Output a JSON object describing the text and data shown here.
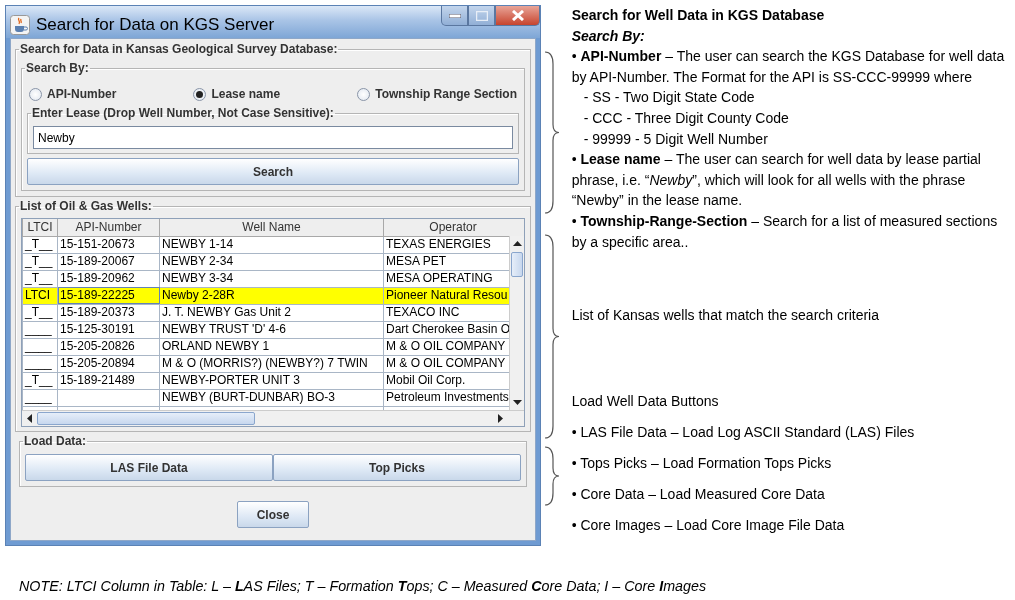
{
  "window": {
    "title": "Search for Data on KGS Server"
  },
  "search_panel": {
    "title": "Search for Data in Kansas Geological Survey Database:",
    "search_by": {
      "title": "Search By:",
      "options": [
        {
          "label": "API-Number",
          "selected": false
        },
        {
          "label": "Lease name",
          "selected": true
        },
        {
          "label": "Township Range Section",
          "selected": false
        }
      ]
    },
    "lease": {
      "title": "Enter Lease (Drop Well Number, Not Case Sensitive):",
      "value": "Newby"
    },
    "search_button": "Search"
  },
  "wells_panel": {
    "title": "List of Oil & Gas Wells:",
    "columns": [
      "LTCI",
      "API-Number",
      "Well Name",
      "Operator"
    ],
    "rows": [
      {
        "ltci": "_T__",
        "api": "15-151-20673",
        "well_name": "NEWBY 1-14",
        "operator": "TEXAS ENERGIES",
        "selected": false
      },
      {
        "ltci": "_T__",
        "api": "15-189-20067",
        "well_name": "NEWBY 2-34",
        "operator": "MESA PET",
        "selected": false
      },
      {
        "ltci": "_T__",
        "api": "15-189-20962",
        "well_name": "NEWBY 3-34",
        "operator": "MESA OPERATING",
        "selected": false
      },
      {
        "ltci": "LTCI",
        "api": "15-189-22225",
        "well_name": "Newby 2-28R",
        "operator": "Pioneer Natural Resou",
        "selected": true
      },
      {
        "ltci": "_T__",
        "api": "15-189-20373",
        "well_name": "J. T. NEWBY Gas Unit 2",
        "operator": "TEXACO INC",
        "selected": false
      },
      {
        "ltci": "____",
        "api": "15-125-30191",
        "well_name": "NEWBY TRUST 'D' 4-6",
        "operator": "Dart Cherokee Basin O",
        "selected": false
      },
      {
        "ltci": "____",
        "api": "15-205-20826",
        "well_name": "ORLAND NEWBY 1",
        "operator": "M & O OIL COMPANY",
        "selected": false
      },
      {
        "ltci": "____",
        "api": "15-205-20894",
        "well_name": "M & O (MORRIS?) (NEWBY?) 7 TWIN",
        "operator": "M & O OIL COMPANY",
        "selected": false
      },
      {
        "ltci": "_T__",
        "api": "15-189-21489",
        "well_name": "NEWBY-PORTER UNIT 3",
        "operator": "Mobil Oil Corp.",
        "selected": false
      },
      {
        "ltci": "____",
        "well_name": "NEWBY (BURT-DUNBAR) BO-3",
        "operator": "Petroleum Investments",
        "selected": false
      }
    ]
  },
  "load_panel": {
    "title": "Load Data:",
    "buttons": [
      "LAS File Data",
      "Top Picks"
    ]
  },
  "close_button": "Close",
  "annotations": {
    "search_help": {
      "title": "Search for Well Data in KGS Database",
      "subtitle": "Search By:",
      "items": [
        {
          "kind": "bullet",
          "text": "• **API-Number** – The user can search the KGS Database for well data by API-Number.  The Format for the API is SS-CCC-99999 where"
        },
        {
          "kind": "sub",
          "text": "- SS - Two Digit State Code"
        },
        {
          "kind": "sub",
          "text": "- CCC - Three Digit County Code"
        },
        {
          "kind": "sub",
          "text": "- 99999 - 5 Digit Well Number"
        },
        {
          "kind": "bullet",
          "text": "• **Lease name** – The user can search for well data by lease partial phrase, i.e. “*Newby*”, which will look for all wells with the phrase “Newby” in the lease name."
        },
        {
          "kind": "bullet",
          "text": "• **Township-Range-Section** – Search for a list of measured sections by a specific area.."
        }
      ]
    },
    "list_help": "List of Kansas wells that match the search criteria",
    "load_help": {
      "title": "Load Well Data Buttons",
      "items": [
        "• LAS File Data – Load Log ASCII Standard (LAS) Files",
        "• Tops Picks – Load Formation Tops Picks",
        "• Core Data – Load Measured Core Data",
        "• Core Images – Load Core Image File Data"
      ]
    }
  },
  "note": "NOTE: LTCI Column in Table: L – **L**AS Files; T – Formation **T**ops; C – Measured **C**ore Data; I – Core **I**mages"
}
